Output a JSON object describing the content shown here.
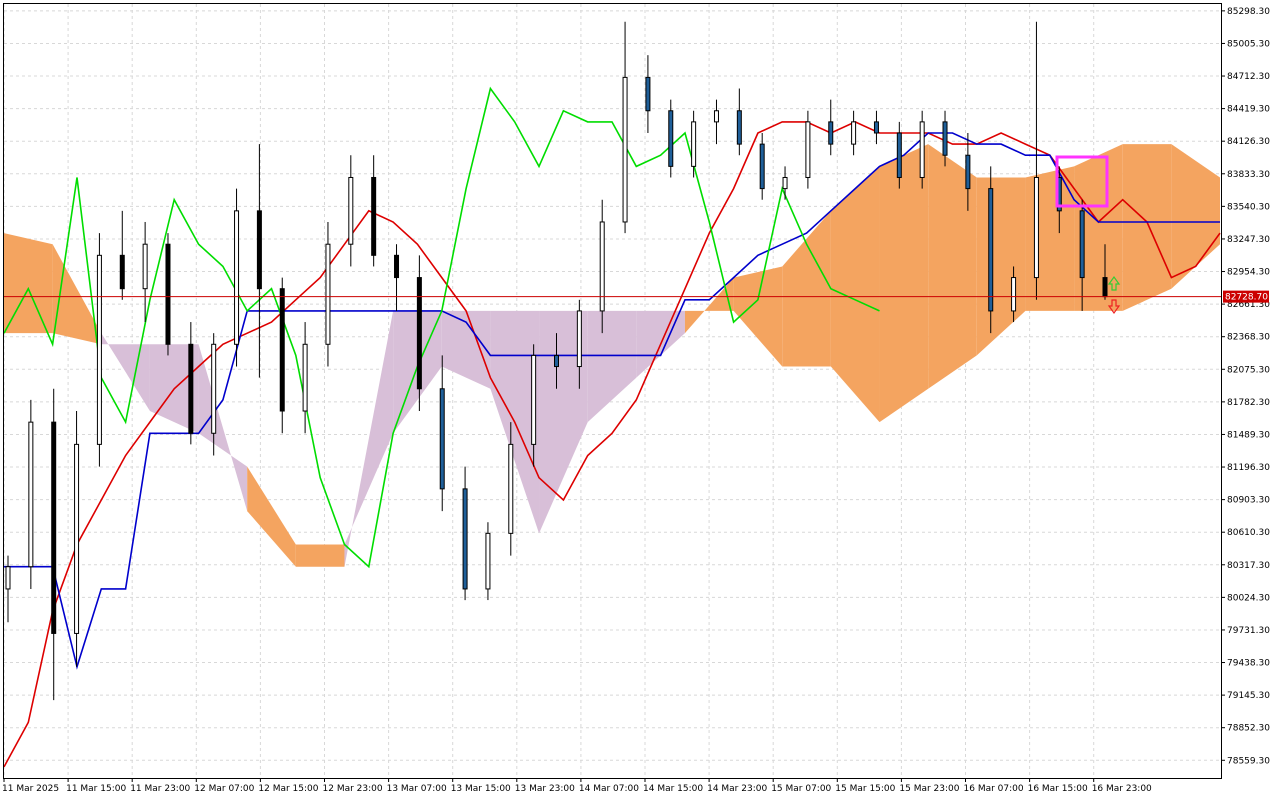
{
  "chart_data": {
    "type": "candlestick",
    "title": "",
    "xlabel": "",
    "ylabel": "",
    "ylim": [
      78400,
      85360
    ],
    "grid": true,
    "x_tick_labels": [
      "11 Mar 2025",
      "11 Mar 15:00",
      "11 Mar 23:00",
      "12 Mar 07:00",
      "12 Mar 15:00",
      "12 Mar 23:00",
      "13 Mar 07:00",
      "13 Mar 15:00",
      "13 Mar 23:00",
      "14 Mar 07:00",
      "14 Mar 15:00",
      "14 Mar 23:00",
      "15 Mar 07:00",
      "15 Mar 15:00",
      "15 Mar 23:00",
      "16 Mar 07:00",
      "16 Mar 15:00",
      "16 Mar 23:00"
    ],
    "y_tick_labels": [
      "85298.30",
      "85005.30",
      "84712.30",
      "84419.30",
      "84126.30",
      "83833.30",
      "83540.30",
      "83247.30",
      "82954.30",
      "82661.30",
      "82368.30",
      "82075.30",
      "81782.30",
      "81489.30",
      "81196.30",
      "80903.30",
      "80610.30",
      "80317.30",
      "80024.30",
      "79731.30",
      "79438.30",
      "79145.30",
      "78852.30",
      "78559.30"
    ],
    "current_price": 82728.7,
    "current_price_label": "82728.70",
    "candles": [
      {
        "t": "11 Mar 2025",
        "o": 80100,
        "h": 80400,
        "l": 79800,
        "c": 80300
      },
      {
        "t": "11 Mar 06:00",
        "o": 80300,
        "h": 81800,
        "l": 80100,
        "c": 81600
      },
      {
        "t": "11 Mar 10:00",
        "o": 81600,
        "h": 81900,
        "l": 79100,
        "c": 79700
      },
      {
        "t": "11 Mar 13:00",
        "o": 79700,
        "h": 81700,
        "l": 79400,
        "c": 81400
      },
      {
        "t": "11 Mar 17:00",
        "o": 81400,
        "h": 83300,
        "l": 81200,
        "c": 83100
      },
      {
        "t": "11 Mar 21:00",
        "o": 83100,
        "h": 83500,
        "l": 82700,
        "c": 82800
      },
      {
        "t": "12 Mar 01:00",
        "o": 82800,
        "h": 83400,
        "l": 82500,
        "c": 83200
      },
      {
        "t": "12 Mar 04:00",
        "o": 83200,
        "h": 83300,
        "l": 82200,
        "c": 82300
      },
      {
        "t": "12 Mar 06:00",
        "o": 82300,
        "h": 82500,
        "l": 81400,
        "c": 81500
      },
      {
        "t": "12 Mar 09:00",
        "o": 81500,
        "h": 82400,
        "l": 81300,
        "c": 82300
      },
      {
        "t": "12 Mar 11:00",
        "o": 82300,
        "h": 83700,
        "l": 82100,
        "c": 83500
      },
      {
        "t": "12 Mar 13:00",
        "o": 83500,
        "h": 84100,
        "l": 82000,
        "c": 82800
      },
      {
        "t": "12 Mar 15:00",
        "o": 82800,
        "h": 82900,
        "l": 81500,
        "c": 81700
      },
      {
        "t": "12 Mar 18:00",
        "o": 81700,
        "h": 82500,
        "l": 81500,
        "c": 82300
      },
      {
        "t": "12 Mar 21:00",
        "o": 82300,
        "h": 83400,
        "l": 82100,
        "c": 83200
      },
      {
        "t": "13 Mar 00:00",
        "o": 83200,
        "h": 84000,
        "l": 83000,
        "c": 83800
      },
      {
        "t": "13 Mar 03:00",
        "o": 83800,
        "h": 84000,
        "l": 83000,
        "c": 83100
      },
      {
        "t": "13 Mar 06:00",
        "o": 83100,
        "h": 83200,
        "l": 82600,
        "c": 82900
      },
      {
        "t": "13 Mar 09:00",
        "o": 82900,
        "h": 83100,
        "l": 81700,
        "c": 81900
      },
      {
        "t": "13 Mar 12:00",
        "o": 81900,
        "h": 82200,
        "l": 80800,
        "c": 81000
      },
      {
        "t": "13 Mar 15:00",
        "o": 81000,
        "h": 81200,
        "l": 80000,
        "c": 80100
      },
      {
        "t": "13 Mar 18:00",
        "o": 80100,
        "h": 80700,
        "l": 80000,
        "c": 80600
      },
      {
        "t": "13 Mar 21:00",
        "o": 80600,
        "h": 81600,
        "l": 80400,
        "c": 81400
      },
      {
        "t": "14 Mar 00:00",
        "o": 81400,
        "h": 82300,
        "l": 81200,
        "c": 82200
      },
      {
        "t": "14 Mar 03:00",
        "o": 82200,
        "h": 82400,
        "l": 81900,
        "c": 82100
      },
      {
        "t": "14 Mar 06:00",
        "o": 82100,
        "h": 82700,
        "l": 81900,
        "c": 82600
      },
      {
        "t": "14 Mar 09:00",
        "o": 82600,
        "h": 83600,
        "l": 82400,
        "c": 83400
      },
      {
        "t": "14 Mar 12:00",
        "o": 83400,
        "h": 85200,
        "l": 83300,
        "c": 84700
      },
      {
        "t": "14 Mar 15:00",
        "o": 84700,
        "h": 84900,
        "l": 84200,
        "c": 84400
      },
      {
        "t": "14 Mar 18:00",
        "o": 84400,
        "h": 84500,
        "l": 83800,
        "c": 83900
      },
      {
        "t": "14 Mar 21:00",
        "o": 83900,
        "h": 84400,
        "l": 83800,
        "c": 84300
      },
      {
        "t": "15 Mar 00:00",
        "o": 84300,
        "h": 84500,
        "l": 84100,
        "c": 84400
      },
      {
        "t": "15 Mar 03:00",
        "o": 84400,
        "h": 84600,
        "l": 84000,
        "c": 84100
      },
      {
        "t": "15 Mar 06:00",
        "o": 84100,
        "h": 84200,
        "l": 83600,
        "c": 83700
      },
      {
        "t": "15 Mar 09:00",
        "o": 83700,
        "h": 83900,
        "l": 83600,
        "c": 83800
      },
      {
        "t": "15 Mar 12:00",
        "o": 83800,
        "h": 84400,
        "l": 83700,
        "c": 84300
      },
      {
        "t": "15 Mar 15:00",
        "o": 84300,
        "h": 84500,
        "l": 84000,
        "c": 84100
      },
      {
        "t": "15 Mar 18:00",
        "o": 84100,
        "h": 84400,
        "l": 84000,
        "c": 84300
      },
      {
        "t": "15 Mar 21:00",
        "o": 84300,
        "h": 84400,
        "l": 84100,
        "c": 84200
      },
      {
        "t": "16 Mar 00:00",
        "o": 84200,
        "h": 84300,
        "l": 83700,
        "c": 83800
      },
      {
        "t": "16 Mar 03:00",
        "o": 83800,
        "h": 84400,
        "l": 83700,
        "c": 84300
      },
      {
        "t": "16 Mar 06:00",
        "o": 84300,
        "h": 84400,
        "l": 83900,
        "c": 84000
      },
      {
        "t": "16 Mar 09:00",
        "o": 84000,
        "h": 84200,
        "l": 83500,
        "c": 83700
      },
      {
        "t": "16 Mar 12:00",
        "o": 83700,
        "h": 83900,
        "l": 82400,
        "c": 82600
      },
      {
        "t": "16 Mar 14:00",
        "o": 82600,
        "h": 83000,
        "l": 82500,
        "c": 82900
      },
      {
        "t": "16 Mar 16:00",
        "o": 82900,
        "h": 85200,
        "l": 82700,
        "c": 83800
      },
      {
        "t": "16 Mar 18:00",
        "o": 83800,
        "h": 83900,
        "l": 83300,
        "c": 83500
      },
      {
        "t": "16 Mar 20:00",
        "o": 83500,
        "h": 83600,
        "l": 82600,
        "c": 82900
      },
      {
        "t": "16 Mar 23:00",
        "o": 82900,
        "h": 83200,
        "l": 82700,
        "c": 82728.7
      }
    ],
    "series": [
      {
        "key": "tenkan",
        "color": "#dd0000",
        "values": [
          [
            0,
            78500
          ],
          [
            2,
            78900
          ],
          [
            4,
            79900
          ],
          [
            6,
            80500
          ],
          [
            8,
            80900
          ],
          [
            10,
            81300
          ],
          [
            12,
            81600
          ],
          [
            14,
            81900
          ],
          [
            16,
            82100
          ],
          [
            18,
            82300
          ],
          [
            20,
            82400
          ],
          [
            22,
            82500
          ],
          [
            24,
            82700
          ],
          [
            26,
            82900
          ],
          [
            28,
            83200
          ],
          [
            30,
            83500
          ],
          [
            32,
            83400
          ],
          [
            34,
            83200
          ],
          [
            36,
            82900
          ],
          [
            38,
            82600
          ],
          [
            40,
            82000
          ],
          [
            42,
            81600
          ],
          [
            44,
            81100
          ],
          [
            46,
            80900
          ],
          [
            48,
            81300
          ],
          [
            50,
            81500
          ],
          [
            52,
            81800
          ],
          [
            54,
            82300
          ],
          [
            56,
            82800
          ],
          [
            58,
            83300
          ],
          [
            60,
            83700
          ],
          [
            62,
            84200
          ],
          [
            64,
            84300
          ],
          [
            66,
            84300
          ],
          [
            68,
            84200
          ],
          [
            70,
            84300
          ],
          [
            72,
            84200
          ],
          [
            74,
            84200
          ],
          [
            76,
            84200
          ],
          [
            78,
            84100
          ],
          [
            80,
            84100
          ],
          [
            82,
            84200
          ],
          [
            84,
            84100
          ],
          [
            86,
            84000
          ],
          [
            88,
            83700
          ],
          [
            90,
            83400
          ],
          [
            92,
            83600
          ],
          [
            94,
            83400
          ],
          [
            96,
            82900
          ],
          [
            98,
            83000
          ],
          [
            100,
            83300
          ]
        ]
      },
      {
        "key": "kijun",
        "color": "#0000cc",
        "values": [
          [
            0,
            80300
          ],
          [
            2,
            80300
          ],
          [
            4,
            80300
          ],
          [
            6,
            79400
          ],
          [
            8,
            80100
          ],
          [
            10,
            80100
          ],
          [
            12,
            81500
          ],
          [
            14,
            81500
          ],
          [
            16,
            81500
          ],
          [
            18,
            81800
          ],
          [
            20,
            82600
          ],
          [
            22,
            82600
          ],
          [
            24,
            82600
          ],
          [
            26,
            82600
          ],
          [
            28,
            82600
          ],
          [
            30,
            82600
          ],
          [
            32,
            82600
          ],
          [
            34,
            82600
          ],
          [
            36,
            82600
          ],
          [
            38,
            82500
          ],
          [
            40,
            82200
          ],
          [
            42,
            82200
          ],
          [
            44,
            82200
          ],
          [
            46,
            82200
          ],
          [
            48,
            82200
          ],
          [
            50,
            82200
          ],
          [
            52,
            82200
          ],
          [
            54,
            82200
          ],
          [
            56,
            82700
          ],
          [
            58,
            82700
          ],
          [
            60,
            82900
          ],
          [
            62,
            83100
          ],
          [
            64,
            83200
          ],
          [
            66,
            83300
          ],
          [
            68,
            83500
          ],
          [
            70,
            83700
          ],
          [
            72,
            83900
          ],
          [
            74,
            84000
          ],
          [
            76,
            84200
          ],
          [
            78,
            84200
          ],
          [
            80,
            84100
          ],
          [
            82,
            84100
          ],
          [
            84,
            84000
          ],
          [
            86,
            84000
          ],
          [
            88,
            83600
          ],
          [
            90,
            83400
          ],
          [
            92,
            83400
          ],
          [
            94,
            83400
          ],
          [
            96,
            83400
          ],
          [
            98,
            83400
          ],
          [
            100,
            83400
          ]
        ]
      },
      {
        "key": "chikou",
        "color": "#00dd00",
        "values": [
          [
            0,
            82400
          ],
          [
            2,
            82800
          ],
          [
            4,
            82300
          ],
          [
            6,
            83800
          ],
          [
            8,
            82000
          ],
          [
            10,
            81600
          ],
          [
            12,
            82700
          ],
          [
            14,
            83600
          ],
          [
            16,
            83200
          ],
          [
            18,
            83000
          ],
          [
            20,
            82600
          ],
          [
            22,
            82800
          ],
          [
            24,
            82200
          ],
          [
            26,
            81100
          ],
          [
            28,
            80500
          ],
          [
            30,
            80300
          ],
          [
            32,
            81500
          ],
          [
            34,
            82100
          ],
          [
            36,
            82600
          ],
          [
            38,
            83700
          ],
          [
            40,
            84600
          ],
          [
            42,
            84300
          ],
          [
            44,
            83900
          ],
          [
            46,
            84400
          ],
          [
            48,
            84300
          ],
          [
            50,
            84300
          ],
          [
            52,
            83900
          ],
          [
            54,
            84000
          ],
          [
            56,
            84200
          ],
          [
            58,
            83400
          ],
          [
            60,
            82500
          ],
          [
            62,
            82700
          ],
          [
            64,
            83700
          ],
          [
            66,
            83200
          ],
          [
            68,
            82800
          ],
          [
            70,
            82700
          ],
          [
            72,
            82600
          ]
        ]
      },
      {
        "key": "senkou_a",
        "color": "#f4a460",
        "values": [
          [
            0,
            83300
          ],
          [
            4,
            83200
          ],
          [
            8,
            82400
          ],
          [
            12,
            81700
          ],
          [
            16,
            81500
          ],
          [
            20,
            81200
          ],
          [
            24,
            80500
          ],
          [
            28,
            80500
          ],
          [
            32,
            81500
          ],
          [
            36,
            82100
          ],
          [
            40,
            81900
          ],
          [
            44,
            80600
          ],
          [
            48,
            81600
          ],
          [
            52,
            82000
          ],
          [
            56,
            82400
          ],
          [
            60,
            82900
          ],
          [
            64,
            83000
          ],
          [
            68,
            83500
          ],
          [
            72,
            83900
          ],
          [
            76,
            84100
          ],
          [
            80,
            83800
          ],
          [
            84,
            83800
          ],
          [
            88,
            83900
          ],
          [
            92,
            84100
          ],
          [
            96,
            84100
          ],
          [
            100,
            83800
          ]
        ]
      },
      {
        "key": "senkou_b",
        "color": "#d8bfd8",
        "values": [
          [
            0,
            82400
          ],
          [
            4,
            82400
          ],
          [
            8,
            82300
          ],
          [
            12,
            82300
          ],
          [
            16,
            82300
          ],
          [
            20,
            80800
          ],
          [
            24,
            80300
          ],
          [
            28,
            80300
          ],
          [
            32,
            82600
          ],
          [
            36,
            82600
          ],
          [
            40,
            82600
          ],
          [
            44,
            82600
          ],
          [
            48,
            82600
          ],
          [
            52,
            82600
          ],
          [
            56,
            82600
          ],
          [
            60,
            82600
          ],
          [
            64,
            82100
          ],
          [
            68,
            82100
          ],
          [
            72,
            81600
          ],
          [
            76,
            81900
          ],
          [
            80,
            82200
          ],
          [
            84,
            82600
          ],
          [
            88,
            82600
          ],
          [
            92,
            82600
          ],
          [
            96,
            82800
          ],
          [
            100,
            83200
          ]
        ]
      }
    ]
  }
}
